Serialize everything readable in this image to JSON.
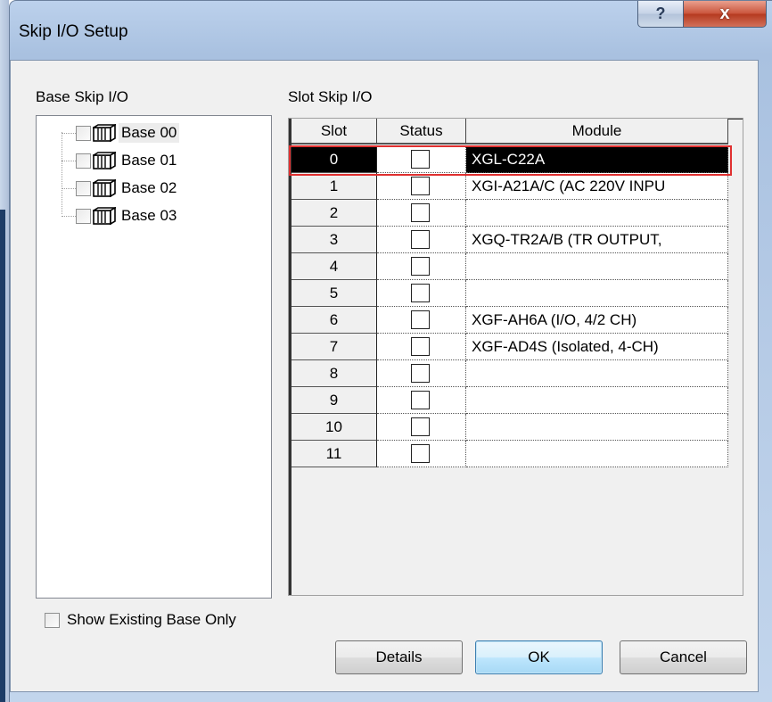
{
  "window": {
    "title": "Skip I/O Setup",
    "help_label": "?",
    "close_label": "x"
  },
  "base_panel": {
    "label": "Base Skip I/O",
    "items": [
      {
        "label": "Base 00",
        "checked": false,
        "selected": true
      },
      {
        "label": "Base 01",
        "checked": false,
        "selected": false
      },
      {
        "label": "Base 02",
        "checked": false,
        "selected": false
      },
      {
        "label": "Base 03",
        "checked": false,
        "selected": false
      }
    ]
  },
  "slot_panel": {
    "label": "Slot Skip I/O",
    "columns": {
      "slot": "Slot",
      "status": "Status",
      "module": "Module"
    },
    "rows": [
      {
        "slot": "0",
        "module": "XGL-C22A",
        "status": false
      },
      {
        "slot": "1",
        "module": "XGI-A21A/C (AC 220V INPU",
        "status": false
      },
      {
        "slot": "2",
        "module": "",
        "status": false
      },
      {
        "slot": "3",
        "module": "XGQ-TR2A/B (TR OUTPUT,",
        "status": false
      },
      {
        "slot": "4",
        "module": "",
        "status": false
      },
      {
        "slot": "5",
        "module": "",
        "status": false
      },
      {
        "slot": "6",
        "module": "XGF-AH6A (I/O, 4/2 CH)",
        "status": false
      },
      {
        "slot": "7",
        "module": "XGF-AD4S (Isolated, 4-CH)",
        "status": false
      },
      {
        "slot": "8",
        "module": "",
        "status": false
      },
      {
        "slot": "9",
        "module": "",
        "status": false
      },
      {
        "slot": "10",
        "module": "",
        "status": false
      },
      {
        "slot": "11",
        "module": "",
        "status": false
      }
    ],
    "selected_row": 0
  },
  "options": {
    "show_existing_label": "Show Existing Base Only",
    "show_existing_checked": false
  },
  "buttons": {
    "details": "Details",
    "ok": "OK",
    "cancel": "Cancel"
  },
  "colors": {
    "selection": "#000000",
    "selection_outline": "#e03030",
    "close_button": "#c9533a"
  }
}
